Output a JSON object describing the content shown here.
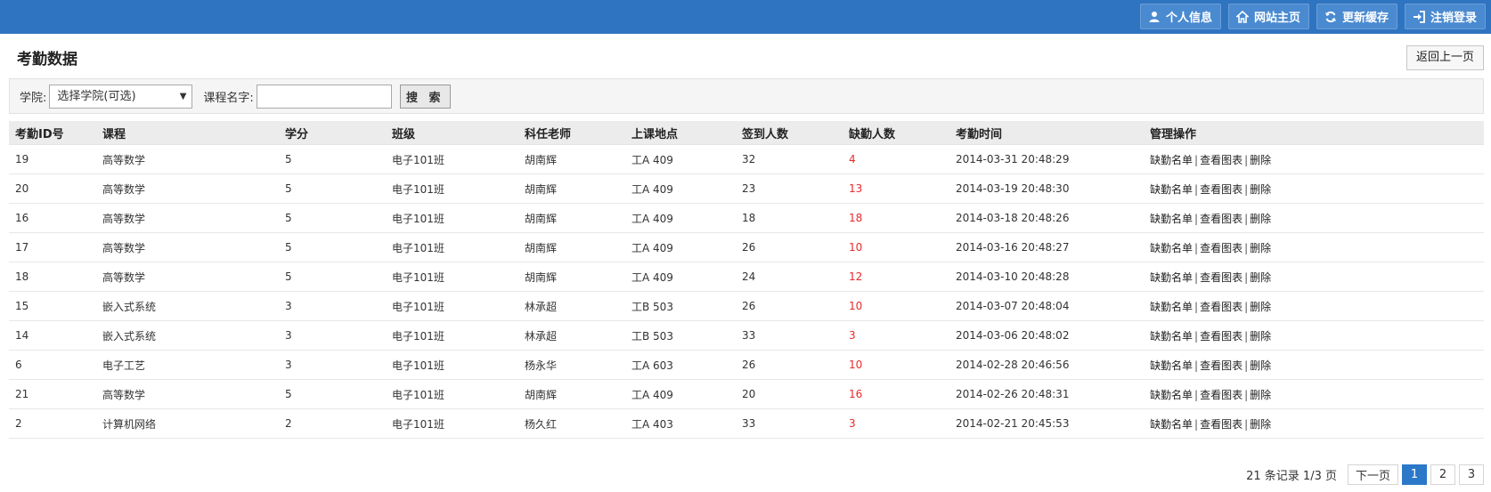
{
  "topnav": [
    {
      "label": "个人信息",
      "icon": "user-icon"
    },
    {
      "label": "网站主页",
      "icon": "home-icon"
    },
    {
      "label": "更新缓存",
      "icon": "refresh-icon"
    },
    {
      "label": "注销登录",
      "icon": "logout-icon"
    }
  ],
  "page": {
    "title": "考勤数据",
    "back_label": "返回上一页"
  },
  "search": {
    "college_label": "学院:",
    "college_selected": "选择学院(可选)",
    "course_label": "课程名字:",
    "course_value": "",
    "button_label": "搜 索"
  },
  "table": {
    "headers": [
      "考勤ID号",
      "课程",
      "学分",
      "班级",
      "科任老师",
      "上课地点",
      "签到人数",
      "缺勤人数",
      "考勤时间",
      "管理操作"
    ],
    "rows": [
      [
        "19",
        "高等数学",
        "5",
        "电子101班",
        "胡南辉",
        "工A 409",
        "32",
        "4",
        "2014-03-31 20:48:29"
      ],
      [
        "20",
        "高等数学",
        "5",
        "电子101班",
        "胡南辉",
        "工A 409",
        "23",
        "13",
        "2014-03-19 20:48:30"
      ],
      [
        "16",
        "高等数学",
        "5",
        "电子101班",
        "胡南辉",
        "工A 409",
        "18",
        "18",
        "2014-03-18 20:48:26"
      ],
      [
        "17",
        "高等数学",
        "5",
        "电子101班",
        "胡南辉",
        "工A 409",
        "26",
        "10",
        "2014-03-16 20:48:27"
      ],
      [
        "18",
        "高等数学",
        "5",
        "电子101班",
        "胡南辉",
        "工A 409",
        "24",
        "12",
        "2014-03-10 20:48:28"
      ],
      [
        "15",
        "嵌入式系统",
        "3",
        "电子101班",
        "林承超",
        "工B 503",
        "26",
        "10",
        "2014-03-07 20:48:04"
      ],
      [
        "14",
        "嵌入式系统",
        "3",
        "电子101班",
        "林承超",
        "工B 503",
        "33",
        "3",
        "2014-03-06 20:48:02"
      ],
      [
        "6",
        "电子工艺",
        "3",
        "电子101班",
        "杨永华",
        "工A 603",
        "26",
        "10",
        "2014-02-28 20:46:56"
      ],
      [
        "21",
        "高等数学",
        "5",
        "电子101班",
        "胡南辉",
        "工A 409",
        "20",
        "16",
        "2014-02-26 20:48:31"
      ],
      [
        "2",
        "计算机网络",
        "2",
        "电子101班",
        "杨久红",
        "工A 403",
        "33",
        "3",
        "2014-02-21 20:45:53"
      ]
    ],
    "ops": [
      "缺勤名单",
      "查看图表",
      "删除"
    ]
  },
  "pager": {
    "info": "21 条记录 1/3 页",
    "next_label": "下一页",
    "pages": [
      "1",
      "2",
      "3"
    ],
    "current": "1"
  },
  "colors": {
    "topbar": "#2f74c1",
    "absent": "#e8292b",
    "active_page": "#2b78c9"
  }
}
